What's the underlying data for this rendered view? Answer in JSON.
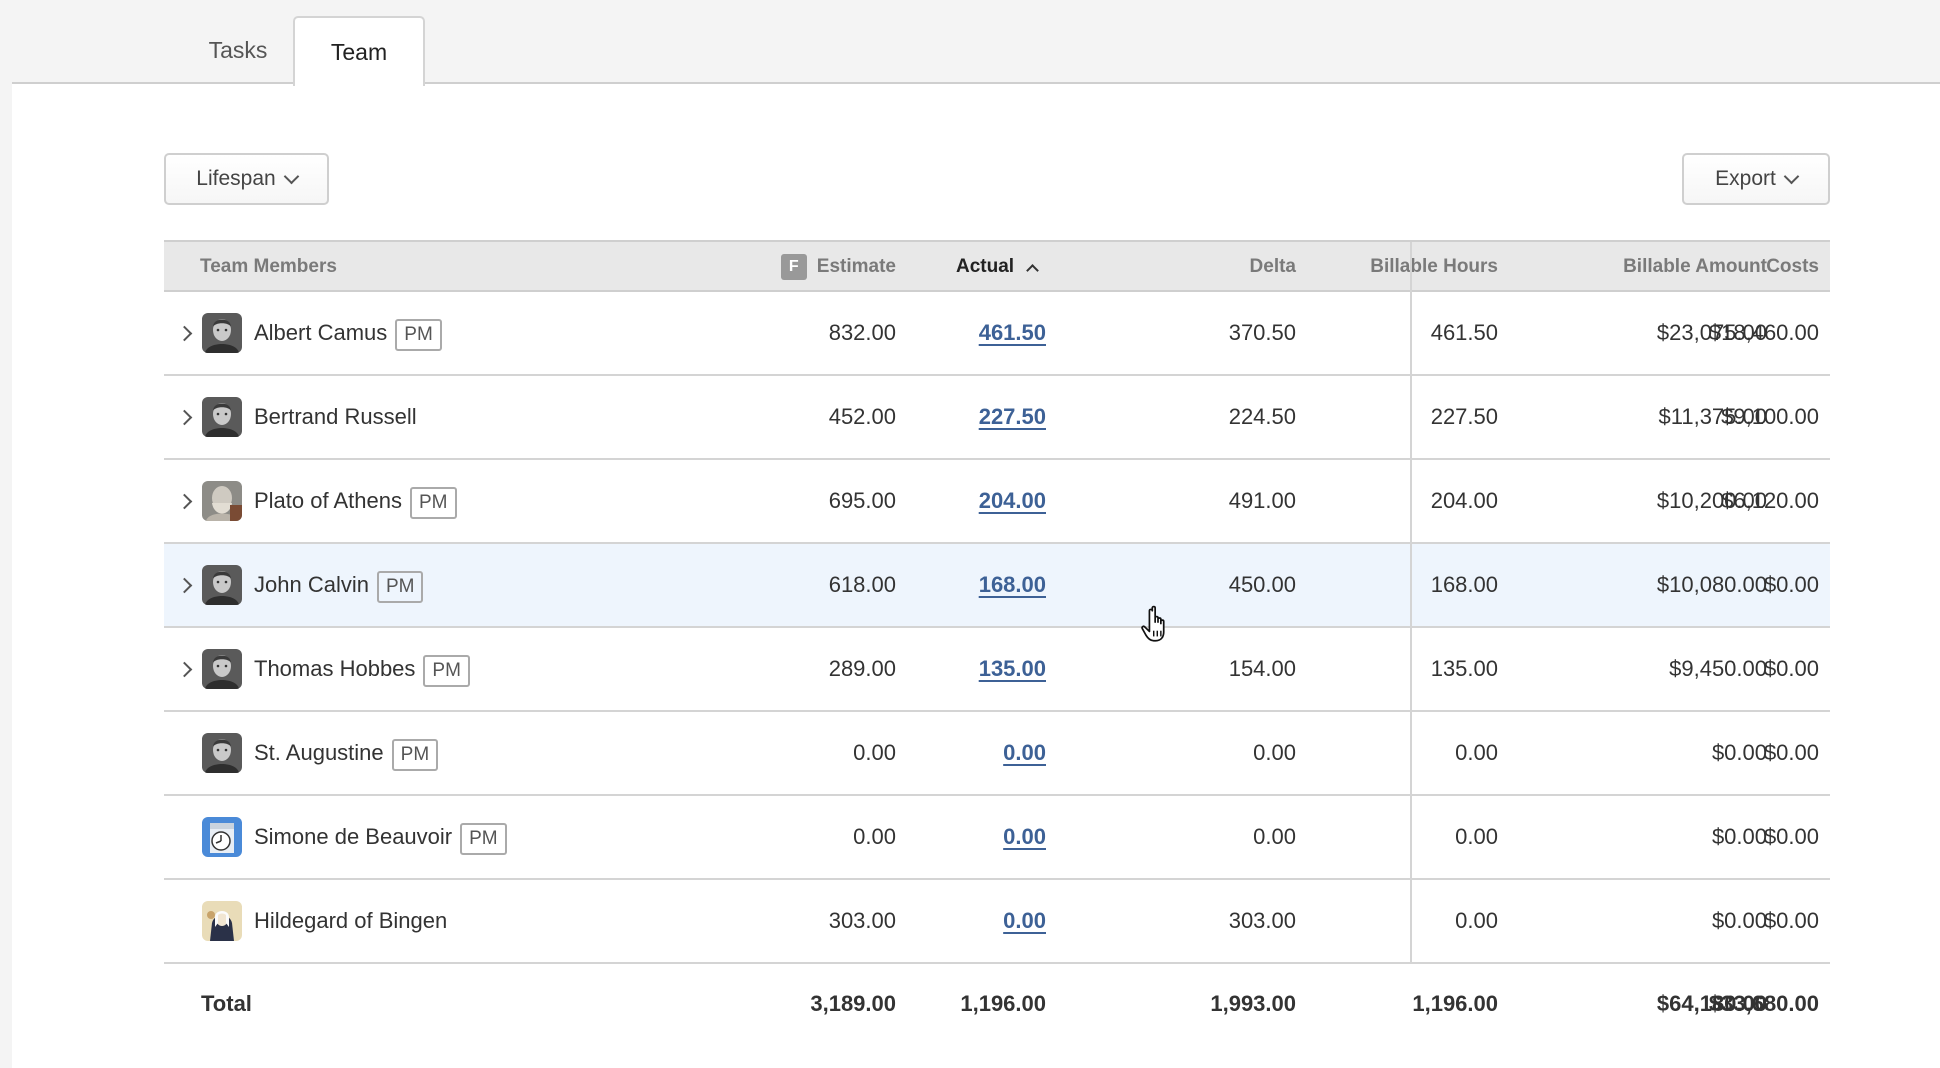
{
  "tabs": [
    {
      "label": "Tasks",
      "active": false
    },
    {
      "label": "Team",
      "active": true
    }
  ],
  "toolbar": {
    "lifespan_label": "Lifespan",
    "export_label": "Export"
  },
  "table": {
    "columns": {
      "team_members": "Team Members",
      "estimate": "Estimate",
      "estimate_badge": "F",
      "actual": "Actual",
      "delta": "Delta",
      "billable_hours": "Billable Hours",
      "billable_amount": "Billable Amount",
      "costs": "Costs"
    },
    "sort": {
      "column": "Actual",
      "direction": "ascending"
    },
    "link_color": "#3d6196",
    "hover_row_color": "#eef5fd",
    "rows": [
      {
        "name": "Albert Camus",
        "pm": "PM",
        "expandable": true,
        "avatar": "portrait-grayscale",
        "estimate": "832.00",
        "actual": "461.50",
        "delta": "370.50",
        "billable_hours": "461.50",
        "billable_amount": "$23,075.00",
        "costs": "$18,460.00"
      },
      {
        "name": "Bertrand Russell",
        "pm": "",
        "expandable": true,
        "avatar": "portrait-grayscale",
        "estimate": "452.00",
        "actual": "227.50",
        "delta": "224.50",
        "billable_hours": "227.50",
        "billable_amount": "$11,375.00",
        "costs": "$9,100.00"
      },
      {
        "name": "Plato of Athens",
        "pm": "PM",
        "expandable": true,
        "avatar": "portrait-bust",
        "estimate": "695.00",
        "actual": "204.00",
        "delta": "491.00",
        "billable_hours": "204.00",
        "billable_amount": "$10,200.00",
        "costs": "$6,120.00"
      },
      {
        "name": "John Calvin",
        "pm": "PM",
        "expandable": true,
        "avatar": "portrait-grayscale",
        "estimate": "618.00",
        "actual": "168.00",
        "delta": "450.00",
        "billable_hours": "168.00",
        "billable_amount": "$10,080.00",
        "costs": "$0.00",
        "hovered": true
      },
      {
        "name": "Thomas Hobbes",
        "pm": "PM",
        "expandable": true,
        "avatar": "portrait-grayscale",
        "estimate": "289.00",
        "actual": "135.00",
        "delta": "154.00",
        "billable_hours": "135.00",
        "billable_amount": "$9,450.00",
        "costs": "$0.00"
      },
      {
        "name": "St. Augustine",
        "pm": "PM",
        "expandable": false,
        "avatar": "portrait-grayscale",
        "estimate": "0.00",
        "actual": "0.00",
        "delta": "0.00",
        "billable_hours": "0.00",
        "billable_amount": "$0.00",
        "costs": "$0.00"
      },
      {
        "name": "Simone de Beauvoir",
        "pm": "PM",
        "expandable": false,
        "avatar": "clock-app-icon",
        "estimate": "0.00",
        "actual": "0.00",
        "delta": "0.00",
        "billable_hours": "0.00",
        "billable_amount": "$0.00",
        "costs": "$0.00"
      },
      {
        "name": "Hildegard of Bingen",
        "pm": "",
        "expandable": false,
        "avatar": "portrait-illumination",
        "estimate": "303.00",
        "actual": "0.00",
        "delta": "303.00",
        "billable_hours": "0.00",
        "billable_amount": "$0.00",
        "costs": "$0.00"
      }
    ],
    "total": {
      "label": "Total",
      "estimate": "3,189.00",
      "actual": "1,196.00",
      "delta": "1,993.00",
      "billable_hours": "1,196.00",
      "billable_amount": "$64,180.00",
      "costs": "$33,680.00"
    }
  }
}
